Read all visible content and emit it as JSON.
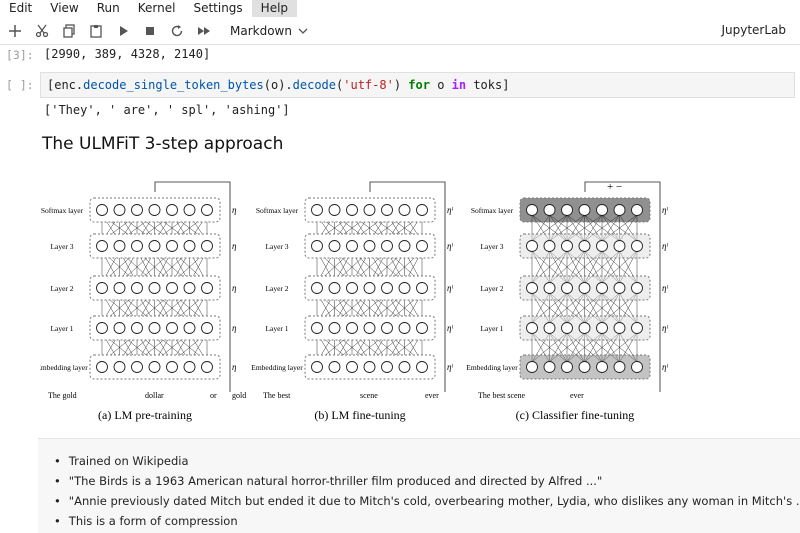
{
  "menu": [
    "Edit",
    "View",
    "Run",
    "Kernel",
    "Settings",
    "Help"
  ],
  "toolbar": {
    "cell_type": "Markdown",
    "kernel": "JupyterLab"
  },
  "cells": {
    "out3_prompt": "[3]:",
    "out3_text": "[2990, 389, 4328, 2140]",
    "in_prompt": "[ ]:",
    "code": {
      "t1": "[enc.",
      "t2": "decode_single_token_bytes",
      "t3": "(o).",
      "t4": "decode",
      "t5": "(",
      "t6": "'utf-8'",
      "t7": ") ",
      "t8": "for",
      "t9": " o ",
      "t10": "in",
      "t11": " toks]"
    },
    "out_text": "['They', ' are', ' spl', 'ashing']",
    "heading": "The ULMFiT 3-step approach"
  },
  "figure": {
    "panels": [
      {
        "caption": "(a) LM pre-training",
        "layers": [
          "Softmax layer",
          "Layer 3",
          "Layer 2",
          "Layer 1",
          "Embedding layer"
        ],
        "bottom_words": [
          "The gold",
          "dollar",
          "or",
          "gold"
        ],
        "eta": "η"
      },
      {
        "caption": "(b) LM fine-tuning",
        "layers": [
          "Softmax layer",
          "Layer 3",
          "Layer 2",
          "Layer 1",
          "Embedding layer"
        ],
        "bottom_words": [
          "The best",
          "scene",
          "ever"
        ],
        "eta": "ηˡ"
      },
      {
        "caption": "(c) Classifier fine-tuning",
        "layers": [
          "Softmax layer",
          "Layer 3",
          "Layer 2",
          "Layer 1",
          "Embedding layer"
        ],
        "bottom_words": [
          "The best scene",
          "ever"
        ],
        "eta": "ηˡ"
      }
    ],
    "plus_minus": "+ −"
  },
  "bullets": [
    "Trained on Wikipedia",
    "\"The Birds is a 1963 American natural horror-thriller film produced and directed by Alfred ...\"",
    "\"Annie previously dated Mitch but ended it due to Mitch's cold, overbearing mother, Lydia, who dislikes any woman in Mitch's ...\"",
    "This is a form of compression"
  ]
}
